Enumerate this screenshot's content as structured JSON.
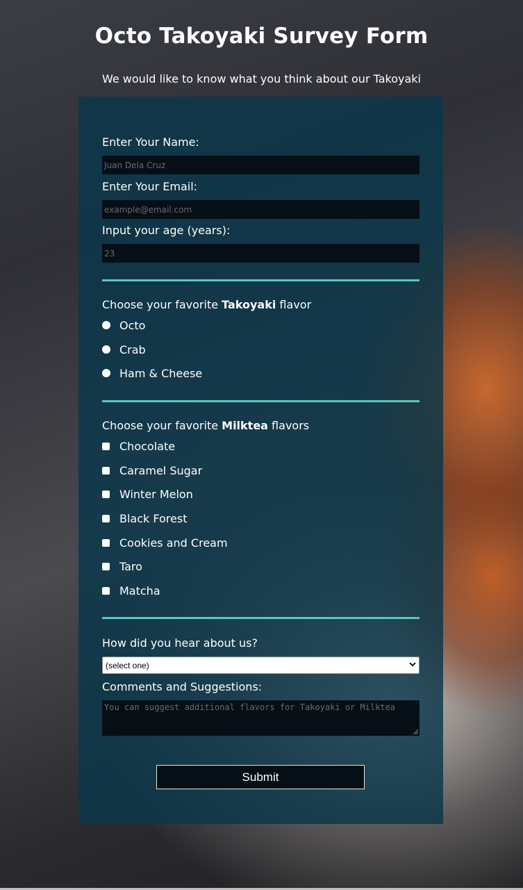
{
  "header": {
    "title": "Octo Takoyaki Survey Form",
    "description": "We would like to know what you think about our Takoyaki"
  },
  "form": {
    "name": {
      "label": "Enter Your Name:",
      "placeholder": "Juan Dela Cruz"
    },
    "email": {
      "label": "Enter Your Email:",
      "placeholder": "example@email.com"
    },
    "age": {
      "label": "Input your age (years):",
      "placeholder": "23"
    },
    "flavor": {
      "label_prefix": "Choose your favorite ",
      "label_bold": "Takoyaki",
      "label_suffix": " flavor",
      "options": [
        "Octo",
        "Crab",
        "Ham & Cheese"
      ]
    },
    "milktea": {
      "label_prefix": "Choose your favorite ",
      "label_bold": "Milktea",
      "label_suffix": " flavors",
      "options": [
        "Chocolate",
        "Caramel Sugar",
        "Winter Melon",
        "Black Forest",
        "Cookies and Cream",
        "Taro",
        "Matcha"
      ]
    },
    "referral": {
      "label": "How did you hear about us?",
      "selected": "(select one)"
    },
    "comments": {
      "label": "Comments and Suggestions:",
      "placeholder": "You can suggest additional flavors for Takoyaki or Milktea"
    },
    "submit_label": "Submit"
  },
  "colors": {
    "accent": "#5cc8c2",
    "panel": "#0a374b",
    "input_bg": "#070f16"
  },
  "icons": {
    "select": "chevron-down-icon",
    "textarea": "resize-grip-icon"
  }
}
